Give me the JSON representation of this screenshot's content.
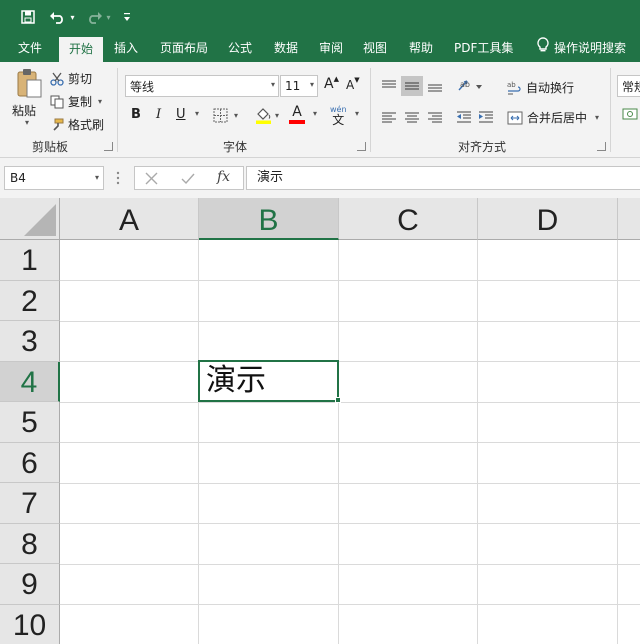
{
  "quick_access": {
    "save": "save",
    "undo": "undo",
    "redo": "redo",
    "customize": "customize"
  },
  "tabs": [
    "文件",
    "开始",
    "插入",
    "页面布局",
    "公式",
    "数据",
    "审阅",
    "视图",
    "帮助",
    "PDF工具集"
  ],
  "active_tab": "开始",
  "tell_me": "操作说明搜索",
  "ribbon": {
    "clipboard": {
      "paste": "粘贴",
      "cut": "剪切",
      "copy": "复制",
      "format_painter": "格式刷",
      "label": "剪贴板"
    },
    "font": {
      "name": "等线",
      "size": "11",
      "grow": "A",
      "shrink": "A",
      "bold": "B",
      "italic": "I",
      "underline": "U",
      "font_color_letter": "A",
      "phonetic": "wén",
      "phonetic_char": "文",
      "label": "字体"
    },
    "alignment": {
      "wrap_text": "自动换行",
      "merge_center": "合并后居中",
      "label": "对齐方式"
    },
    "number": {
      "format": "常规"
    }
  },
  "formula_bar": {
    "name_box": "B4",
    "fx": "fx",
    "content": "演示"
  },
  "sheet": {
    "columns": [
      "A",
      "B",
      "C",
      "D"
    ],
    "rows": [
      "1",
      "2",
      "3",
      "4",
      "5",
      "6",
      "7",
      "8",
      "9",
      "10"
    ],
    "selected_column": "B",
    "selected_row": "4",
    "cells": {
      "B4": "演示"
    }
  },
  "colors": {
    "accent": "#217346",
    "ribbon": "#f3f3f3",
    "header": "#e6e6e6"
  }
}
